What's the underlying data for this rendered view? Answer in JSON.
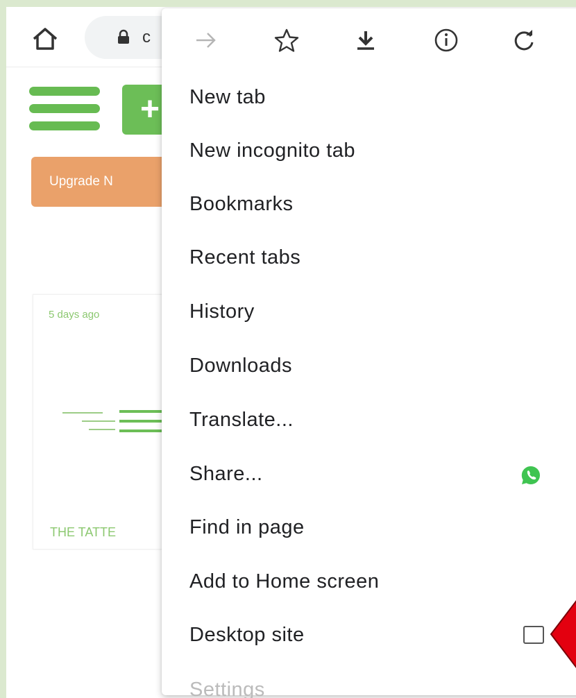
{
  "browser": {
    "url_text": "c",
    "icons": [
      "home-icon",
      "lock-icon"
    ]
  },
  "page": {
    "upgrade_label": "Upgrade N",
    "add_label": "+",
    "card": {
      "date": "5 days ago",
      "title": "THE TATTE"
    }
  },
  "menu": {
    "top_icons": [
      "forward-arrow-icon",
      "star-icon",
      "download-icon",
      "info-icon",
      "reload-icon"
    ],
    "items": [
      {
        "label": "New tab"
      },
      {
        "label": "New incognito tab"
      },
      {
        "label": "Bookmarks"
      },
      {
        "label": "Recent tabs"
      },
      {
        "label": "History"
      },
      {
        "label": "Downloads"
      },
      {
        "label": "Translate..."
      },
      {
        "label": "Share...",
        "trailing_icon": "whatsapp-icon"
      },
      {
        "label": "Find in page"
      },
      {
        "label": "Add to Home screen"
      },
      {
        "label": "Desktop site",
        "checkbox_checked": false
      },
      {
        "label": "Settings"
      }
    ]
  },
  "colors": {
    "frame": "#dbe9cf",
    "green": "#67bb52",
    "orange": "#eaa16a",
    "arrow_red": "#e3000f"
  }
}
